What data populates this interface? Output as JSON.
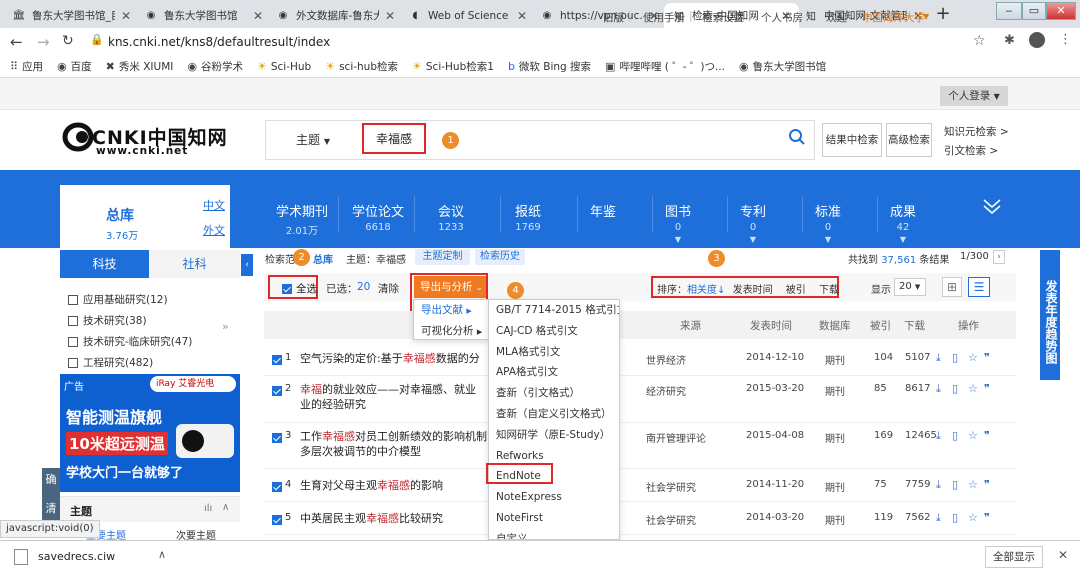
{
  "browser": {
    "tabs": [
      {
        "label": "鲁东大学图书馆_目",
        "icon": "library-icon"
      },
      {
        "label": "鲁东大学图书馆",
        "icon": "globe-icon"
      },
      {
        "label": "外文数据库-鲁东大",
        "icon": "globe-icon"
      },
      {
        "label": "Web of Science [v",
        "icon": "wos-icon"
      },
      {
        "label": "https://vpn.ouc.ed",
        "icon": "globe-icon"
      },
      {
        "label": "检索-中国知网",
        "icon": "cnki-icon"
      },
      {
        "label": "中国知网-文献管理",
        "icon": "cnki-icon"
      }
    ],
    "url": "kns.cnki.net/kns8/defaultresult/index",
    "bookmarks": [
      "应用",
      "百度",
      "秀米 XIUMI",
      "谷粉学术",
      "Sci-Hub",
      "sci-hub检索",
      "Sci-Hub检索1",
      "微软 Bing 搜索",
      "哔哩哔哩 ( ゜- ゜)つ...",
      "鲁东大学图书馆"
    ]
  },
  "top_links": [
    "旧版",
    "使用手册",
    "检索设置",
    "个人书房",
    "欢迎",
    "中国海洋大学",
    "个人登录"
  ],
  "logo": {
    "main": "CNKI中国知网",
    "sub": "www.cnki.net"
  },
  "search": {
    "field": "主题",
    "query": "幸福感",
    "btn_in_result": "结果中检索",
    "btn_advanced": "高级检索",
    "knowledge_search": "知识元检索 >",
    "citation_search": "引文检索 >"
  },
  "nav": {
    "zongku": {
      "label": "总库",
      "count": "3.76万"
    },
    "lang": [
      "中文",
      "外文"
    ],
    "items": [
      {
        "label": "学术期刊",
        "count": "2.01万"
      },
      {
        "label": "学位论文",
        "count": "6618"
      },
      {
        "label": "会议",
        "count": "1233"
      },
      {
        "label": "报纸",
        "count": "1769"
      },
      {
        "label": "年鉴",
        "count": ""
      },
      {
        "label": "图书",
        "count": "0"
      },
      {
        "label": "专利",
        "count": "0"
      },
      {
        "label": "标准",
        "count": "0"
      },
      {
        "label": "成果",
        "count": "42"
      }
    ]
  },
  "sidebar": {
    "tabs": [
      "科技",
      "社科"
    ],
    "filters": [
      "应用基础研究(12)",
      "技术研究(38)",
      "技术研究-临床研究(47)",
      "工程研究(482)"
    ],
    "ad": {
      "tag": "广告",
      "brand": "iRay 艾睿光电",
      "line1": "智能测温旗舰",
      "line2": "10米超远测温",
      "line3": "学校大门一台就够了"
    },
    "section": "主题",
    "subtabs": [
      "主要主题",
      "次要主题"
    ],
    "side_labels": [
      "确",
      "清"
    ]
  },
  "results_bar": {
    "scope_label": "检索范围：",
    "scope_value": "总库",
    "topic": "主题：幸福感",
    "topic_custom": "主题定制",
    "history": "检索历史",
    "found": "共找到",
    "found_count": "37,561",
    "found_suffix": "条结果",
    "page": "1/300"
  },
  "toolbar": {
    "select_all": "全选",
    "selected_label": "已选：",
    "selected_count": "20",
    "clear": "清除",
    "export": "导出与分析",
    "sort_label": "排序：",
    "sort_options": [
      "相关度",
      "发表时间",
      "被引",
      "下载"
    ],
    "display_label": "显示",
    "display_value": "20"
  },
  "export_menu": {
    "items": [
      "导出文献",
      "可视化分析"
    ]
  },
  "format_menu": {
    "items": [
      "GB/T 7714-2015 格式引文",
      "CAJ-CD 格式引文",
      "MLA格式引文",
      "APA格式引文",
      "查新（引文格式）",
      "查新（自定义引文格式）",
      "知网研学（原E-Study）",
      "Refworks",
      "EndNote",
      "NoteExpress",
      "NoteFirst",
      "自定义"
    ]
  },
  "table": {
    "headers": [
      "来源",
      "发表时间",
      "数据库",
      "被引",
      "下载",
      "操作"
    ],
    "rows": [
      {
        "n": "1",
        "pre": "空气污染的定价:基于",
        "hl": "幸福感",
        "post": "数据的分",
        "line2": "",
        "source": "世界经济",
        "date": "2014-12-10",
        "db": "期刊",
        "cite": "104",
        "dl": "5107"
      },
      {
        "n": "2",
        "pre": "",
        "hl": "幸福",
        "post": "的就业效应——对幸福感、就业",
        "line2": "业的经验研究",
        "source": "经济研究",
        "date": "2015-03-20",
        "db": "期刊",
        "cite": "85",
        "dl": "8617"
      },
      {
        "n": "3",
        "pre": "工作",
        "hl": "幸福感",
        "post": "对员工创新绩效的影响机制",
        "line2": "多层次被调节的中介模型",
        "source": "南开管理评论",
        "date": "2015-04-08",
        "db": "期刊",
        "cite": "169",
        "dl": "12465"
      },
      {
        "n": "4",
        "pre": "生育对父母主观",
        "hl": "幸福感",
        "post": "的影响",
        "line2": "",
        "source": "社会学研究",
        "date": "2014-11-20",
        "db": "期刊",
        "cite": "75",
        "dl": "7759"
      },
      {
        "n": "5",
        "pre": "中英居民主观",
        "hl": "幸福感",
        "post": "比较研究",
        "line2": "",
        "source": "社会学研究",
        "date": "2014-03-20",
        "db": "期刊",
        "cite": "119",
        "dl": "7562"
      }
    ]
  },
  "right_tab": "发表年度趋势图",
  "annotations": [
    "1",
    "2",
    "3",
    "4"
  ],
  "status_text": "javascript:void(0)",
  "download": {
    "file": "savedrecs.ciw",
    "show_all": "全部显示"
  },
  "colors": {
    "cnki_blue": "#1e6fd9",
    "highlight": "#c0282f",
    "export_orange": "#f07a21",
    "annotation": "#e0282c"
  }
}
